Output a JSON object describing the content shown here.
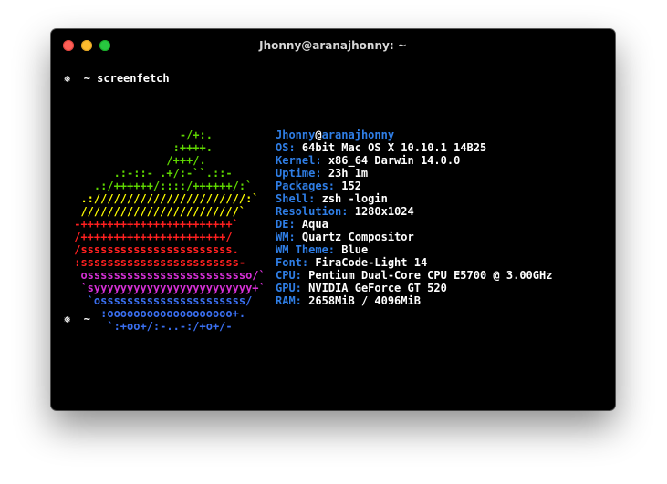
{
  "window": {
    "title": "Jhonny@aranajhonny: ~"
  },
  "prompt": {
    "symbol": "❅",
    "tilde": "~",
    "command": "screenfetch"
  },
  "ascii_rows": [
    {
      "text": "                 -/+:.",
      "color": "#5fd700"
    },
    {
      "text": "                :++++.",
      "color": "#5fd700"
    },
    {
      "text": "               /+++/.",
      "color": "#5fd700"
    },
    {
      "text": "       .:-::- .+/:-``.::-",
      "color": "#5fd700"
    },
    {
      "text": "    .:/++++++/::::/++++++/:`",
      "color": "#5fd700"
    },
    {
      "text": "  .:///////////////////////:`",
      "color": "#ffff00"
    },
    {
      "text": "  ////////////////////////`",
      "color": "#ffff00"
    },
    {
      "text": " -+++++++++++++++++++++++`",
      "color": "#ff2020"
    },
    {
      "text": " /++++++++++++++++++++++/",
      "color": "#ff2020"
    },
    {
      "text": " /sssssssssssssssssssssss.",
      "color": "#ff2020"
    },
    {
      "text": " :ssssssssssssssssssssssss-",
      "color": "#ff2020"
    },
    {
      "text": "  osssssssssssssssssssssssso/`",
      "color": "#d630d6"
    },
    {
      "text": "  `syyyyyyyyyyyyyyyyyyyyyyyy+`",
      "color": "#d630d6"
    },
    {
      "text": "   `ossssssssssssssssssssss/",
      "color": "#3a6ff0"
    },
    {
      "text": "     :ooooooooooooooooooo+.",
      "color": "#3a6ff0"
    },
    {
      "text": "      `:+oo+/:-..-:/+o+/-",
      "color": "#3a6ff0"
    }
  ],
  "info": {
    "user": "Jhonny",
    "at": "@",
    "host": "aranajhonny",
    "fields": [
      {
        "label": "OS:",
        "value": "64bit Mac OS X 10.10.1 14B25"
      },
      {
        "label": "Kernel:",
        "value": "x86_64 Darwin 14.0.0"
      },
      {
        "label": "Uptime:",
        "value": "23h 1m"
      },
      {
        "label": "Packages:",
        "value": "152"
      },
      {
        "label": "Shell:",
        "value": "zsh -login"
      },
      {
        "label": "Resolution:",
        "value": "1280x1024"
      },
      {
        "label": "DE:",
        "value": "Aqua"
      },
      {
        "label": "WM:",
        "value": "Quartz Compositor"
      },
      {
        "label": "WM Theme:",
        "value": "Blue"
      },
      {
        "label": "Font:",
        "value": "FiraCode-Light 14"
      },
      {
        "label": "CPU:",
        "value": "Pentium Dual-Core CPU E5700 @ 3.00GHz"
      },
      {
        "label": "GPU:",
        "value": "NVIDIA GeForce GT 520"
      },
      {
        "label": "RAM:",
        "value": "2658MiB / 4096MiB"
      }
    ]
  },
  "colors": {
    "label": "#2f7ee6",
    "background": "#000000"
  }
}
